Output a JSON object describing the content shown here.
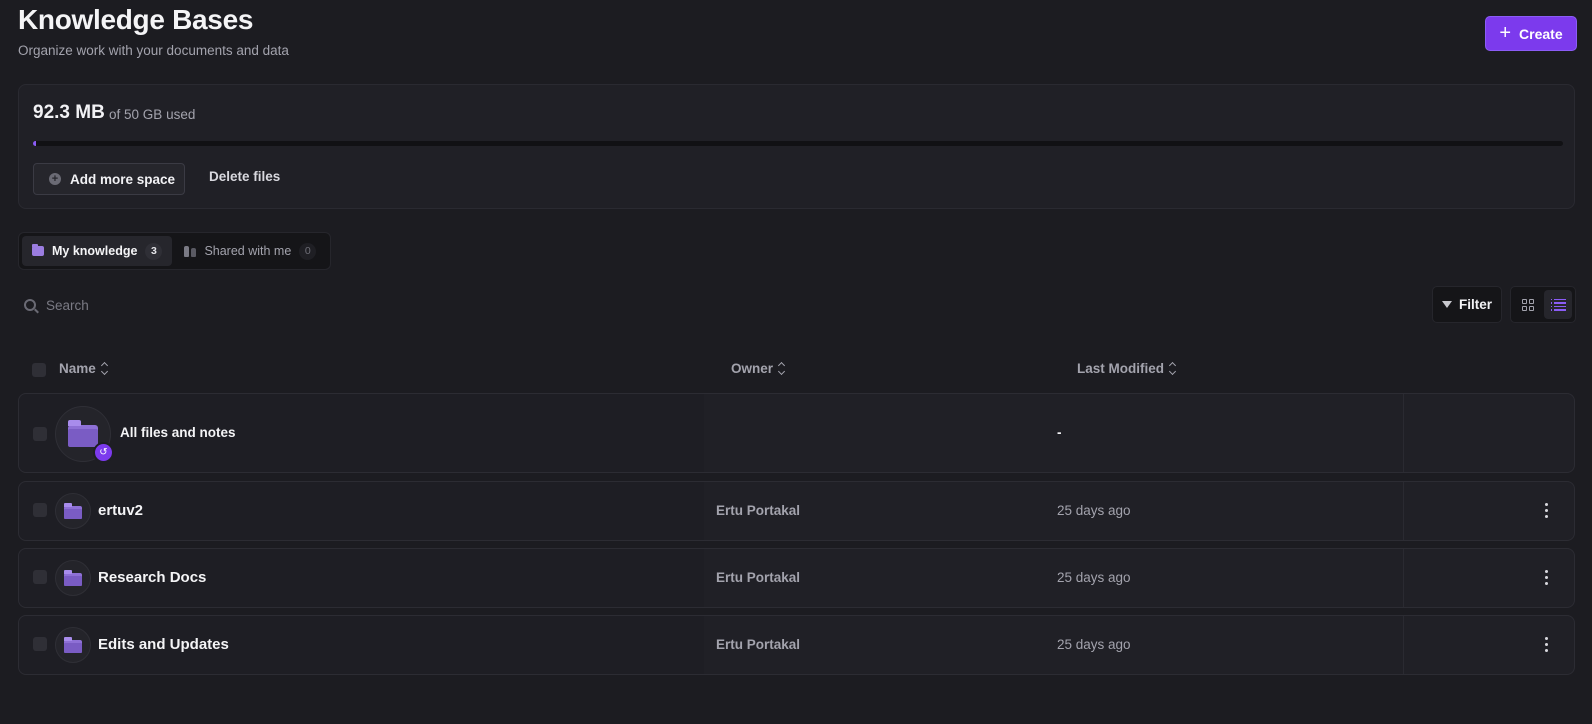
{
  "header": {
    "title": "Knowledge Bases",
    "subtitle": "Organize work with your documents and data",
    "create_label": "Create"
  },
  "storage": {
    "used": "92.3 MB",
    "of_text": "of",
    "total": "50 GB",
    "used_suffix": "used",
    "percent_used": 0.18,
    "add_space_label": "Add more space",
    "delete_files_label": "Delete files"
  },
  "tabs": [
    {
      "label": "My knowledge",
      "count": "3",
      "active": true,
      "icon": "folder-icon"
    },
    {
      "label": "Shared with me",
      "count": "0",
      "active": false,
      "icon": "people-icon"
    }
  ],
  "search": {
    "placeholder": "Search"
  },
  "toolbar": {
    "filter_label": "Filter",
    "view_mode": "list"
  },
  "table": {
    "columns": [
      "Name",
      "Owner",
      "Last Modified"
    ],
    "rows": [
      {
        "name": "All files and notes",
        "owner": "",
        "modified": "-",
        "icon": "folder-icon",
        "badge": "history-icon"
      },
      {
        "name": "ertuv2",
        "owner": "Ertu Portakal",
        "modified": "25 days ago",
        "icon": "folder-icon"
      },
      {
        "name": "Research Docs",
        "owner": "Ertu Portakal",
        "modified": "25 days ago",
        "icon": "folder-icon"
      },
      {
        "name": "Edits and Updates",
        "owner": "Ertu Portakal",
        "modified": "25 days ago",
        "icon": "folder-icon"
      }
    ]
  },
  "colors": {
    "accent": "#7c3aed",
    "background": "#1c1c21",
    "card": "#202026"
  }
}
